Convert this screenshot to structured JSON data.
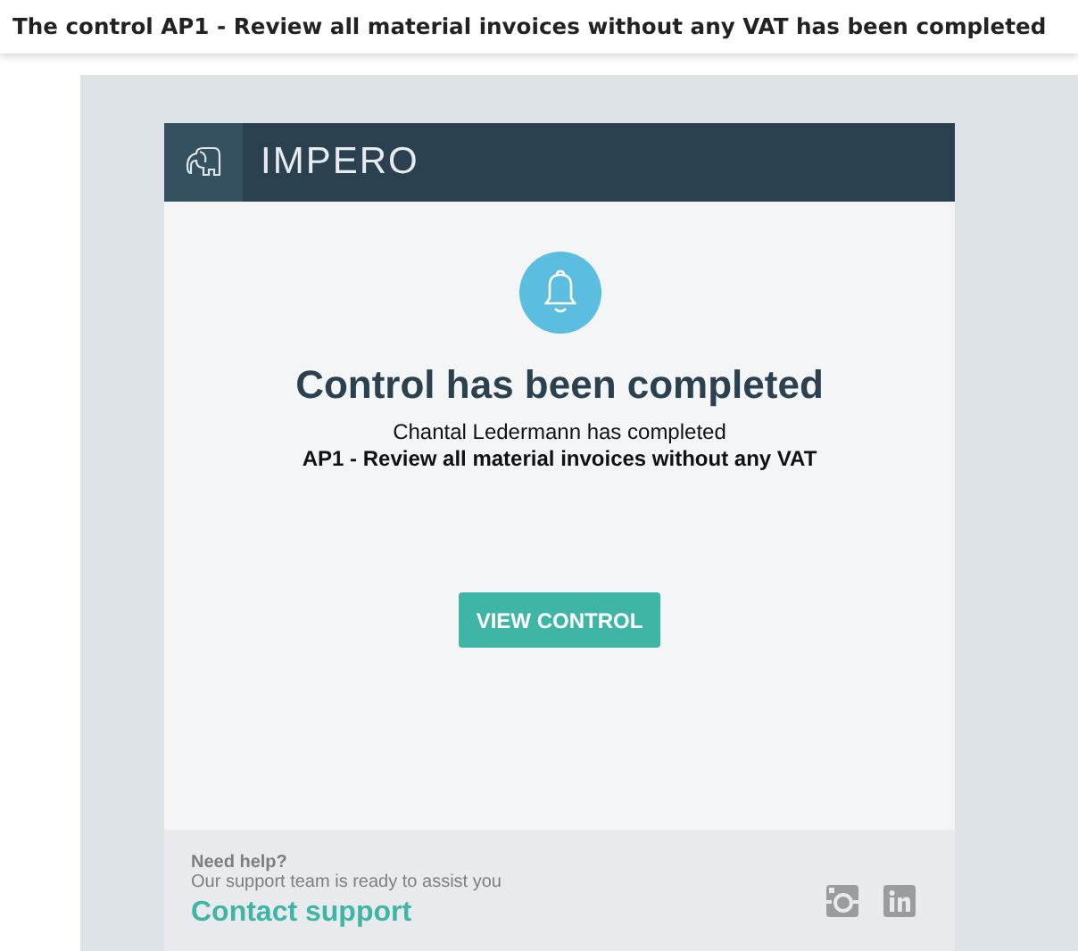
{
  "subject": "The control AP1 - Review all material invoices without any VAT has been completed",
  "email": {
    "brand": "IMPERO",
    "heading": "Control has been completed",
    "line": "Chantal Ledermann has completed",
    "control_name": "AP1 - Review all material invoices without any VAT",
    "button": "VIEW CONTROL",
    "footer": {
      "title": "Need help?",
      "subtitle": "Our support team is ready to assist you",
      "link": "Contact support"
    }
  }
}
